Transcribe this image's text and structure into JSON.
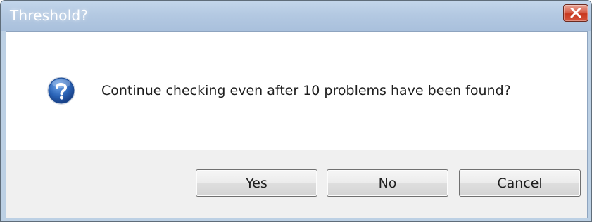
{
  "dialog": {
    "title": "Threshold?",
    "message": "Continue checking even after 10 problems have been found?",
    "icon": "question-icon",
    "close_icon": "close-icon"
  },
  "buttons": {
    "yes": "Yes",
    "no": "No",
    "cancel": "Cancel"
  },
  "colors": {
    "title_bar": "#b4c9e2",
    "close_button": "#c8381f",
    "icon_blue": "#2a63b6",
    "button_bar": "#f0f0f0"
  }
}
